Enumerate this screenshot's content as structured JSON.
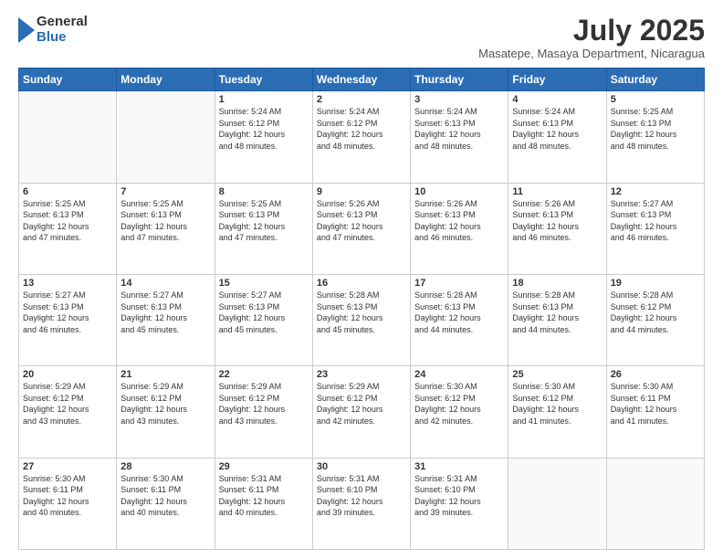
{
  "logo": {
    "general": "General",
    "blue": "Blue"
  },
  "title": {
    "month_year": "July 2025",
    "location": "Masatepe, Masaya Department, Nicaragua"
  },
  "weekdays": [
    "Sunday",
    "Monday",
    "Tuesday",
    "Wednesday",
    "Thursday",
    "Friday",
    "Saturday"
  ],
  "weeks": [
    [
      {
        "day": "",
        "info": ""
      },
      {
        "day": "",
        "info": ""
      },
      {
        "day": "1",
        "info": "Sunrise: 5:24 AM\nSunset: 6:12 PM\nDaylight: 12 hours\nand 48 minutes."
      },
      {
        "day": "2",
        "info": "Sunrise: 5:24 AM\nSunset: 6:12 PM\nDaylight: 12 hours\nand 48 minutes."
      },
      {
        "day": "3",
        "info": "Sunrise: 5:24 AM\nSunset: 6:13 PM\nDaylight: 12 hours\nand 48 minutes."
      },
      {
        "day": "4",
        "info": "Sunrise: 5:24 AM\nSunset: 6:13 PM\nDaylight: 12 hours\nand 48 minutes."
      },
      {
        "day": "5",
        "info": "Sunrise: 5:25 AM\nSunset: 6:13 PM\nDaylight: 12 hours\nand 48 minutes."
      }
    ],
    [
      {
        "day": "6",
        "info": "Sunrise: 5:25 AM\nSunset: 6:13 PM\nDaylight: 12 hours\nand 47 minutes."
      },
      {
        "day": "7",
        "info": "Sunrise: 5:25 AM\nSunset: 6:13 PM\nDaylight: 12 hours\nand 47 minutes."
      },
      {
        "day": "8",
        "info": "Sunrise: 5:25 AM\nSunset: 6:13 PM\nDaylight: 12 hours\nand 47 minutes."
      },
      {
        "day": "9",
        "info": "Sunrise: 5:26 AM\nSunset: 6:13 PM\nDaylight: 12 hours\nand 47 minutes."
      },
      {
        "day": "10",
        "info": "Sunrise: 5:26 AM\nSunset: 6:13 PM\nDaylight: 12 hours\nand 46 minutes."
      },
      {
        "day": "11",
        "info": "Sunrise: 5:26 AM\nSunset: 6:13 PM\nDaylight: 12 hours\nand 46 minutes."
      },
      {
        "day": "12",
        "info": "Sunrise: 5:27 AM\nSunset: 6:13 PM\nDaylight: 12 hours\nand 46 minutes."
      }
    ],
    [
      {
        "day": "13",
        "info": "Sunrise: 5:27 AM\nSunset: 6:13 PM\nDaylight: 12 hours\nand 46 minutes."
      },
      {
        "day": "14",
        "info": "Sunrise: 5:27 AM\nSunset: 6:13 PM\nDaylight: 12 hours\nand 45 minutes."
      },
      {
        "day": "15",
        "info": "Sunrise: 5:27 AM\nSunset: 6:13 PM\nDaylight: 12 hours\nand 45 minutes."
      },
      {
        "day": "16",
        "info": "Sunrise: 5:28 AM\nSunset: 6:13 PM\nDaylight: 12 hours\nand 45 minutes."
      },
      {
        "day": "17",
        "info": "Sunrise: 5:28 AM\nSunset: 6:13 PM\nDaylight: 12 hours\nand 44 minutes."
      },
      {
        "day": "18",
        "info": "Sunrise: 5:28 AM\nSunset: 6:13 PM\nDaylight: 12 hours\nand 44 minutes."
      },
      {
        "day": "19",
        "info": "Sunrise: 5:28 AM\nSunset: 6:12 PM\nDaylight: 12 hours\nand 44 minutes."
      }
    ],
    [
      {
        "day": "20",
        "info": "Sunrise: 5:29 AM\nSunset: 6:12 PM\nDaylight: 12 hours\nand 43 minutes."
      },
      {
        "day": "21",
        "info": "Sunrise: 5:29 AM\nSunset: 6:12 PM\nDaylight: 12 hours\nand 43 minutes."
      },
      {
        "day": "22",
        "info": "Sunrise: 5:29 AM\nSunset: 6:12 PM\nDaylight: 12 hours\nand 43 minutes."
      },
      {
        "day": "23",
        "info": "Sunrise: 5:29 AM\nSunset: 6:12 PM\nDaylight: 12 hours\nand 42 minutes."
      },
      {
        "day": "24",
        "info": "Sunrise: 5:30 AM\nSunset: 6:12 PM\nDaylight: 12 hours\nand 42 minutes."
      },
      {
        "day": "25",
        "info": "Sunrise: 5:30 AM\nSunset: 6:12 PM\nDaylight: 12 hours\nand 41 minutes."
      },
      {
        "day": "26",
        "info": "Sunrise: 5:30 AM\nSunset: 6:11 PM\nDaylight: 12 hours\nand 41 minutes."
      }
    ],
    [
      {
        "day": "27",
        "info": "Sunrise: 5:30 AM\nSunset: 6:11 PM\nDaylight: 12 hours\nand 40 minutes."
      },
      {
        "day": "28",
        "info": "Sunrise: 5:30 AM\nSunset: 6:11 PM\nDaylight: 12 hours\nand 40 minutes."
      },
      {
        "day": "29",
        "info": "Sunrise: 5:31 AM\nSunset: 6:11 PM\nDaylight: 12 hours\nand 40 minutes."
      },
      {
        "day": "30",
        "info": "Sunrise: 5:31 AM\nSunset: 6:10 PM\nDaylight: 12 hours\nand 39 minutes."
      },
      {
        "day": "31",
        "info": "Sunrise: 5:31 AM\nSunset: 6:10 PM\nDaylight: 12 hours\nand 39 minutes."
      },
      {
        "day": "",
        "info": ""
      },
      {
        "day": "",
        "info": ""
      }
    ]
  ]
}
